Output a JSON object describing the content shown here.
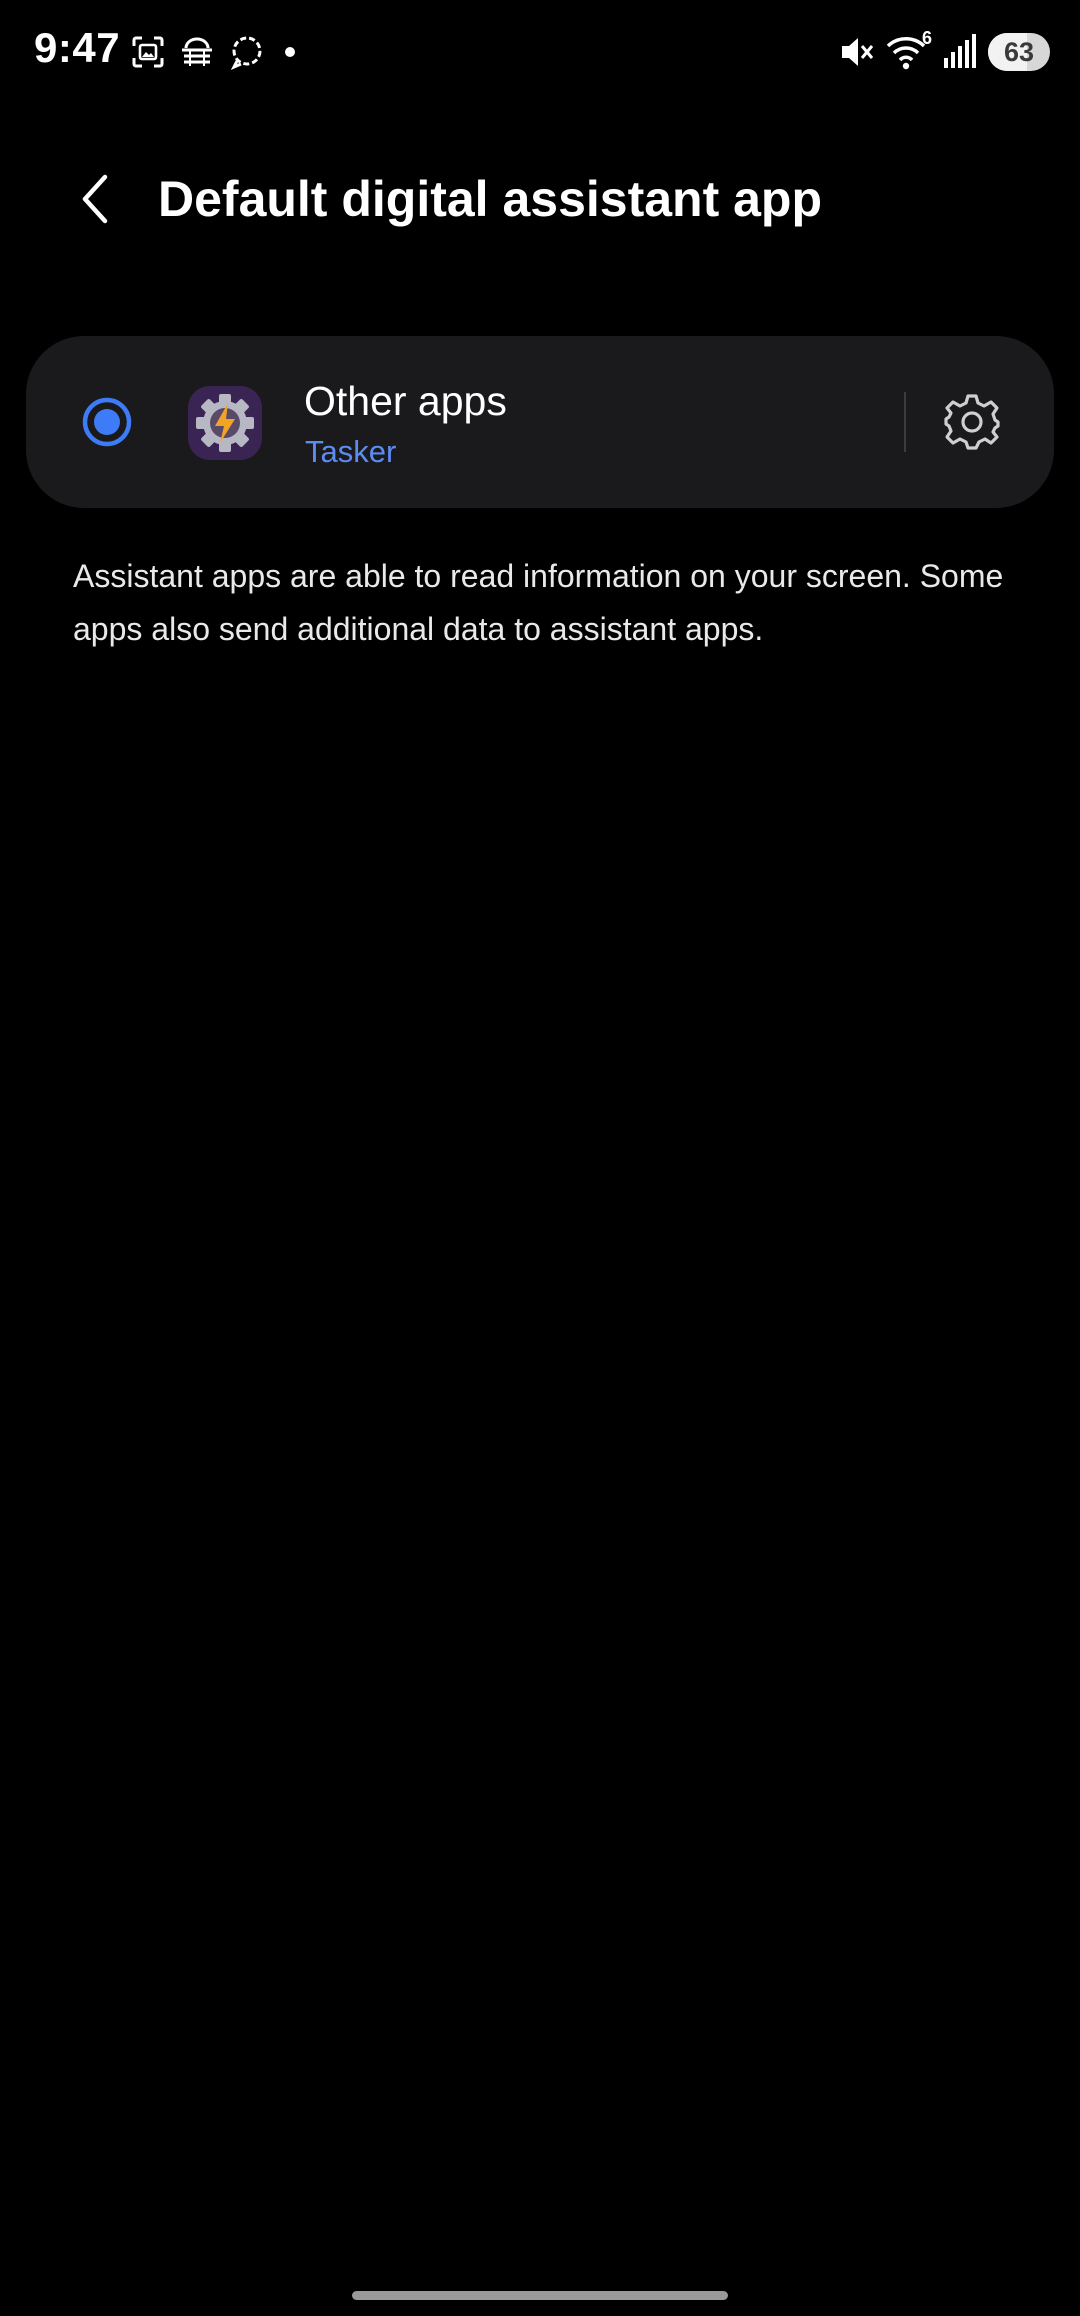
{
  "status_bar": {
    "time": "9:47",
    "left_icons": [
      "screenshot-icon",
      "router-icon",
      "signal-messenger-icon",
      "dot-icon"
    ],
    "right_icons": [
      "mute-icon",
      "wifi-icon",
      "cellular-signal-icon",
      "battery-icon"
    ],
    "wifi_label": "6",
    "battery_level": "63",
    "battery_fraction": 0.63
  },
  "header": {
    "back_icon": "chevron-left-icon",
    "title": "Default digital assistant app"
  },
  "assistant_option": {
    "selected": true,
    "title": "Other apps",
    "subtitle": "Tasker",
    "app_icon": "tasker-icon",
    "settings_icon": "gear-icon"
  },
  "description": "Assistant apps are able to read information on your screen. Some apps also send additional data to assistant apps.",
  "colors": {
    "background": "#000000",
    "card": "#1a1a1c",
    "accent": "#3e7cf7",
    "subtitle": "#5b8cf4"
  }
}
